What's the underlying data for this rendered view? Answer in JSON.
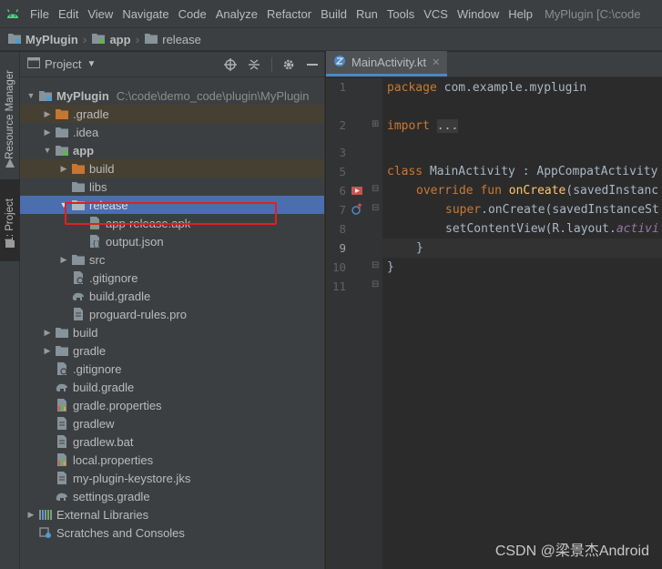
{
  "menubar": {
    "items": [
      "File",
      "Edit",
      "View",
      "Navigate",
      "Code",
      "Analyze",
      "Refactor",
      "Build",
      "Run",
      "Tools",
      "VCS",
      "Window",
      "Help"
    ],
    "window_title": "MyPlugin [C:\\code"
  },
  "breadcrumb": [
    "MyPlugin",
    "app",
    "release"
  ],
  "left_strip": {
    "resource_manager": "Resource Manager",
    "project": "1: Project"
  },
  "project_panel": {
    "title": "Project",
    "tree": [
      {
        "label": "MyPlugin",
        "path": "C:\\code\\demo_code\\plugin\\MyPlugin",
        "icon": "module-folder",
        "expanded": true
      },
      {
        "label": ".gradle",
        "icon": "folder-orange"
      },
      {
        "label": ".idea",
        "icon": "folder"
      },
      {
        "label": "app",
        "icon": "module-folder",
        "expanded": true
      },
      {
        "label": "build",
        "icon": "folder-orange"
      },
      {
        "label": "libs",
        "icon": "folder"
      },
      {
        "label": "release",
        "icon": "folder",
        "expanded": true
      },
      {
        "label": "app-release.apk",
        "icon": "apk-file"
      },
      {
        "label": "output.json",
        "icon": "json-file"
      },
      {
        "label": "src",
        "icon": "folder"
      },
      {
        "label": ".gitignore",
        "icon": "ignore-file"
      },
      {
        "label": "build.gradle",
        "icon": "gradle-file"
      },
      {
        "label": "proguard-rules.pro",
        "icon": "text-file"
      },
      {
        "label": "build",
        "icon": "folder"
      },
      {
        "label": "gradle",
        "icon": "folder"
      },
      {
        "label": ".gitignore",
        "icon": "ignore-file"
      },
      {
        "label": "build.gradle",
        "icon": "gradle-file"
      },
      {
        "label": "gradle.properties",
        "icon": "properties-file"
      },
      {
        "label": "gradlew",
        "icon": "text-file"
      },
      {
        "label": "gradlew.bat",
        "icon": "text-file"
      },
      {
        "label": "local.properties",
        "icon": "properties-file"
      },
      {
        "label": "my-plugin-keystore.jks",
        "icon": "text-file"
      },
      {
        "label": "settings.gradle",
        "icon": "gradle-file"
      },
      {
        "label": "External Libraries",
        "icon": "libraries"
      },
      {
        "label": "Scratches and Consoles",
        "icon": "scratches"
      }
    ]
  },
  "editor": {
    "tab_label": "MainActivity.kt",
    "line_numbers": [
      "1",
      "2",
      "3",
      "5",
      "6",
      "7",
      "8",
      "9",
      "10",
      "11"
    ],
    "current_line": "9",
    "code": {
      "l1_kw": "package",
      "l1_rest": " com.example.myplugin",
      "l3_kw": "import",
      "l3_fold": "...",
      "l6_kw": "class",
      "l6_rest": " MainActivity : AppCompatActivity",
      "l7_kw1": "override",
      "l7_kw2": "fun",
      "l7_fn": "onCreate",
      "l7_rest": "(savedInstanc",
      "l8_kw": "super",
      "l8_rest": ".onCreate(savedInstanceSt",
      "l9_rest": "setContentView(R.layout.",
      "l9_it": "activi",
      "l10": "}",
      "l11": "}"
    }
  },
  "watermark": "CSDN @梁景杰Android",
  "colors": {
    "selection": "#4b6eaf",
    "highlight_box": "#e02020",
    "keyword": "#cc7832",
    "function": "#ffc66d"
  }
}
